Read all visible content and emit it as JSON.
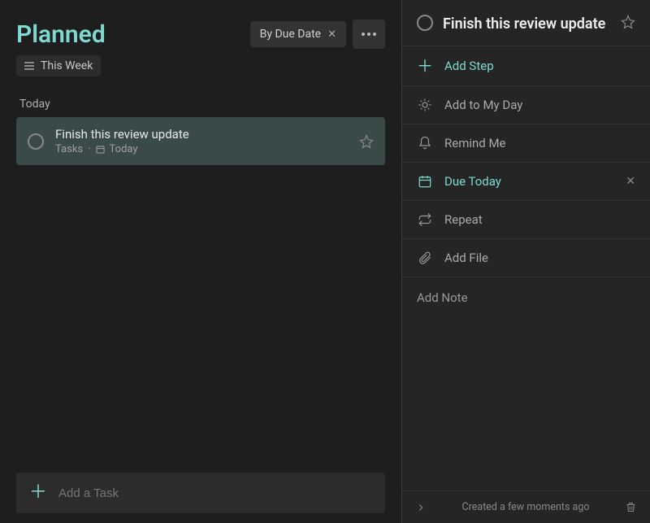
{
  "header": {
    "title": "Planned",
    "sort_label": "By Due Date"
  },
  "filter": {
    "label": "This Week"
  },
  "group": {
    "label": "Today"
  },
  "task": {
    "title": "Finish this review update",
    "list": "Tasks",
    "due": "Today"
  },
  "add_task": {
    "placeholder": "Add a Task"
  },
  "detail": {
    "title": "Finish this review update",
    "add_step": "Add Step",
    "my_day": "Add to My Day",
    "remind": "Remind Me",
    "due": "Due Today",
    "repeat": "Repeat",
    "file": "Add File",
    "note_placeholder": "Add Note",
    "created": "Created a few moments ago"
  }
}
